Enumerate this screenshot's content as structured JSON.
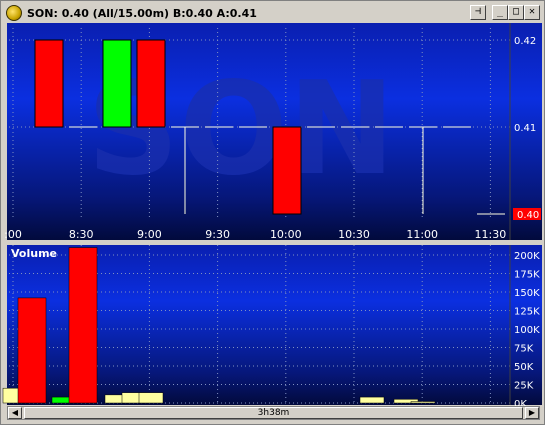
{
  "window": {
    "title": "SON: 0.40 (All/15.00m)  B:0.40 A:0.41",
    "pin_label": "⊣",
    "min_label": "_",
    "max_label": "□",
    "close_label": "✕"
  },
  "watermark": "SON",
  "colors": {
    "bg_top": "#0a1a8c",
    "bg_mid": "#0b2bd8",
    "bg_bottom": "#020a40",
    "up": "#00ff00",
    "down": "#ff0000",
    "doji": "#fffbd0",
    "vol_neutral": "#ffffa0",
    "grid": "#8090c0"
  },
  "scrollbar": {
    "label": "3h38m",
    "left_icon": "arrow-left-icon",
    "right_icon": "arrow-right-icon"
  },
  "chart_data": [
    {
      "type": "candlestick",
      "title": "",
      "x_ticks": [
        ":00",
        "8:30",
        "9:00",
        "9:30",
        "10:00",
        "10:30",
        "11:00",
        "11:30"
      ],
      "y_ticks": [
        "0.42",
        "0.41"
      ],
      "ylim": [
        0.4,
        0.42
      ],
      "last_price_label": "0.40",
      "candles": [
        {
          "open": 0.42,
          "high": 0.42,
          "low": 0.41,
          "close": 0.41
        },
        {
          "open": 0.41,
          "high": 0.41,
          "low": 0.41,
          "close": 0.41
        },
        {
          "open": 0.41,
          "high": 0.42,
          "low": 0.41,
          "close": 0.42
        },
        {
          "open": 0.42,
          "high": 0.42,
          "low": 0.41,
          "close": 0.41
        },
        {
          "open": 0.41,
          "high": 0.41,
          "low": 0.4,
          "close": 0.41
        },
        {
          "open": 0.41,
          "high": 0.41,
          "low": 0.41,
          "close": 0.41
        },
        {
          "open": 0.41,
          "high": 0.41,
          "low": 0.41,
          "close": 0.41
        },
        {
          "open": 0.41,
          "high": 0.41,
          "low": 0.4,
          "close": 0.4
        },
        {
          "open": 0.41,
          "high": 0.41,
          "low": 0.41,
          "close": 0.41
        },
        {
          "open": 0.41,
          "high": 0.41,
          "low": 0.41,
          "close": 0.41
        },
        {
          "open": 0.41,
          "high": 0.41,
          "low": 0.41,
          "close": 0.41
        },
        {
          "open": 0.41,
          "high": 0.41,
          "low": 0.4,
          "close": 0.41
        },
        {
          "open": 0.41,
          "high": 0.41,
          "low": 0.41,
          "close": 0.41
        },
        {
          "open": 0.4,
          "high": 0.4,
          "low": 0.4,
          "close": 0.4
        }
      ]
    },
    {
      "type": "bar",
      "title": "Volume",
      "y_ticks": [
        "200K",
        "175K",
        "150K",
        "125K",
        "100K",
        "75K",
        "50K",
        "25K",
        "0K"
      ],
      "ylim": [
        0,
        200000
      ],
      "values": [
        20000,
        142000,
        0,
        8000,
        210000,
        0,
        11000,
        14000,
        14000,
        0,
        0,
        0,
        0,
        0,
        0,
        0,
        0,
        0,
        0,
        0,
        0,
        8000,
        0,
        5000,
        2000
      ],
      "colors": [
        "neutral",
        "down",
        "neutral",
        "up",
        "down",
        "neutral",
        "neutral",
        "neutral",
        "neutral",
        "neutral",
        "neutral",
        "neutral",
        "neutral",
        "neutral",
        "neutral",
        "neutral",
        "neutral",
        "neutral",
        "neutral",
        "neutral",
        "neutral",
        "neutral",
        "neutral",
        "neutral",
        "neutral"
      ]
    }
  ]
}
